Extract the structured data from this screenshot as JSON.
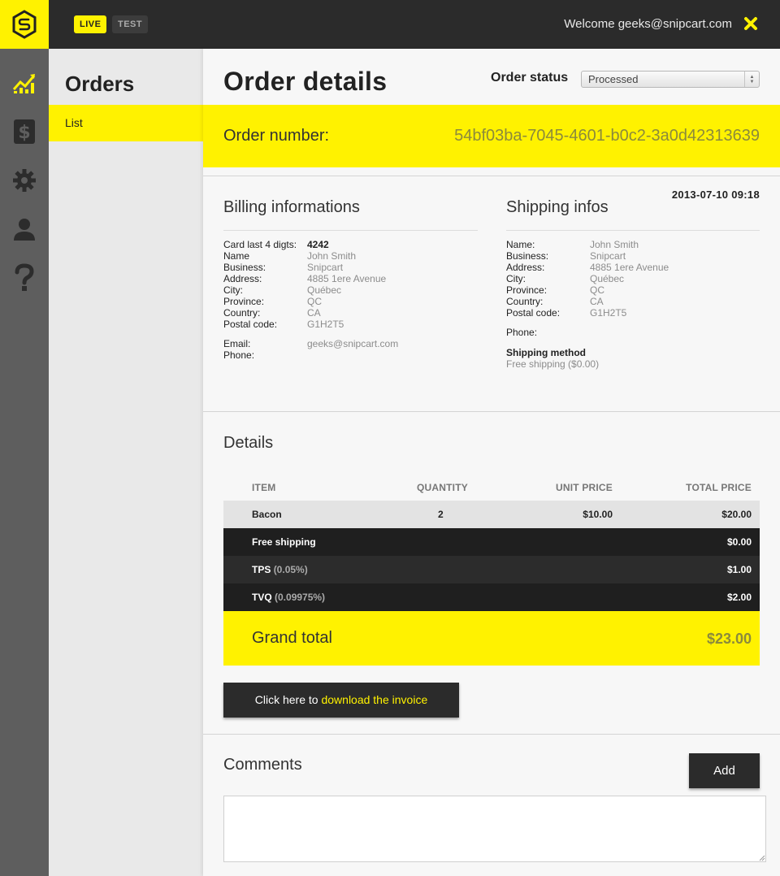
{
  "topbar": {
    "env_live": "LIVE",
    "env_test": "TEST",
    "welcome": "Welcome geeks@snipcart.com"
  },
  "colors": {
    "accent": "#fff200",
    "dark": "#2b2b2b",
    "rail": "#5e5e5e"
  },
  "rail": {
    "icons": [
      "chart-icon",
      "dollar-icon",
      "gear-icon",
      "user-icon",
      "help-icon"
    ]
  },
  "subnav": {
    "title": "Orders",
    "items": [
      {
        "label": "List",
        "active": true
      }
    ]
  },
  "page": {
    "title": "Order details",
    "status_label": "Order status",
    "status_value": "Processed",
    "order_label": "Order number:",
    "order_number": "54bf03ba-7045-4601-b0c2-3a0d42313639",
    "date": "2013-07-10 09:18"
  },
  "billing": {
    "heading": "Billing informations",
    "rows": [
      {
        "k": "Card last 4 digts:",
        "v": "4242"
      },
      {
        "k": "Name",
        "v": "John Smith"
      },
      {
        "k": "Business:",
        "v": "Snipcart"
      },
      {
        "k": "Address:",
        "v": "4885 1ere Avenue"
      },
      {
        "k": "City:",
        "v": "Québec"
      },
      {
        "k": "Province:",
        "v": "QC"
      },
      {
        "k": "Country:",
        "v": "CA"
      },
      {
        "k": "Postal code:",
        "v": "G1H2T5"
      }
    ],
    "email_label": "Email:",
    "email": "geeks@snipcart.com",
    "phone_label": "Phone:"
  },
  "shipping": {
    "heading": "Shipping infos",
    "rows": [
      {
        "k": "Name:",
        "v": "John Smith"
      },
      {
        "k": "Business:",
        "v": "Snipcart"
      },
      {
        "k": "Address:",
        "v": "4885 1ere Avenue"
      },
      {
        "k": "City:",
        "v": "Québec"
      },
      {
        "k": "Province:",
        "v": "QC"
      },
      {
        "k": "Country:",
        "v": "CA"
      },
      {
        "k": "Postal code:",
        "v": "G1H2T5"
      }
    ],
    "phone_label": "Phone:",
    "method_label": "Shipping method",
    "method_value": "Free shipping ($0.00)"
  },
  "details": {
    "heading": "Details",
    "columns": [
      "ITEM",
      "QUANTITY",
      "UNIT PRICE",
      "TOTAL PRICE"
    ],
    "items": [
      {
        "name": "Bacon",
        "quantity": "2",
        "unit_price": "$10.00",
        "total": "$20.00"
      }
    ],
    "shipping": {
      "name": "Free shipping",
      "total": "$0.00"
    },
    "taxes": [
      {
        "name": "TPS",
        "rate": "(0.05%)",
        "total": "$1.00"
      },
      {
        "name": "TVQ",
        "rate": "(0.09975%)",
        "total": "$2.00"
      }
    ],
    "grand_total_label": "Grand total",
    "grand_total": "$23.00",
    "invoice_prefix": "Click here to",
    "invoice_link": "download the invoice"
  },
  "comments": {
    "heading": "Comments",
    "add_label": "Add",
    "value": ""
  }
}
